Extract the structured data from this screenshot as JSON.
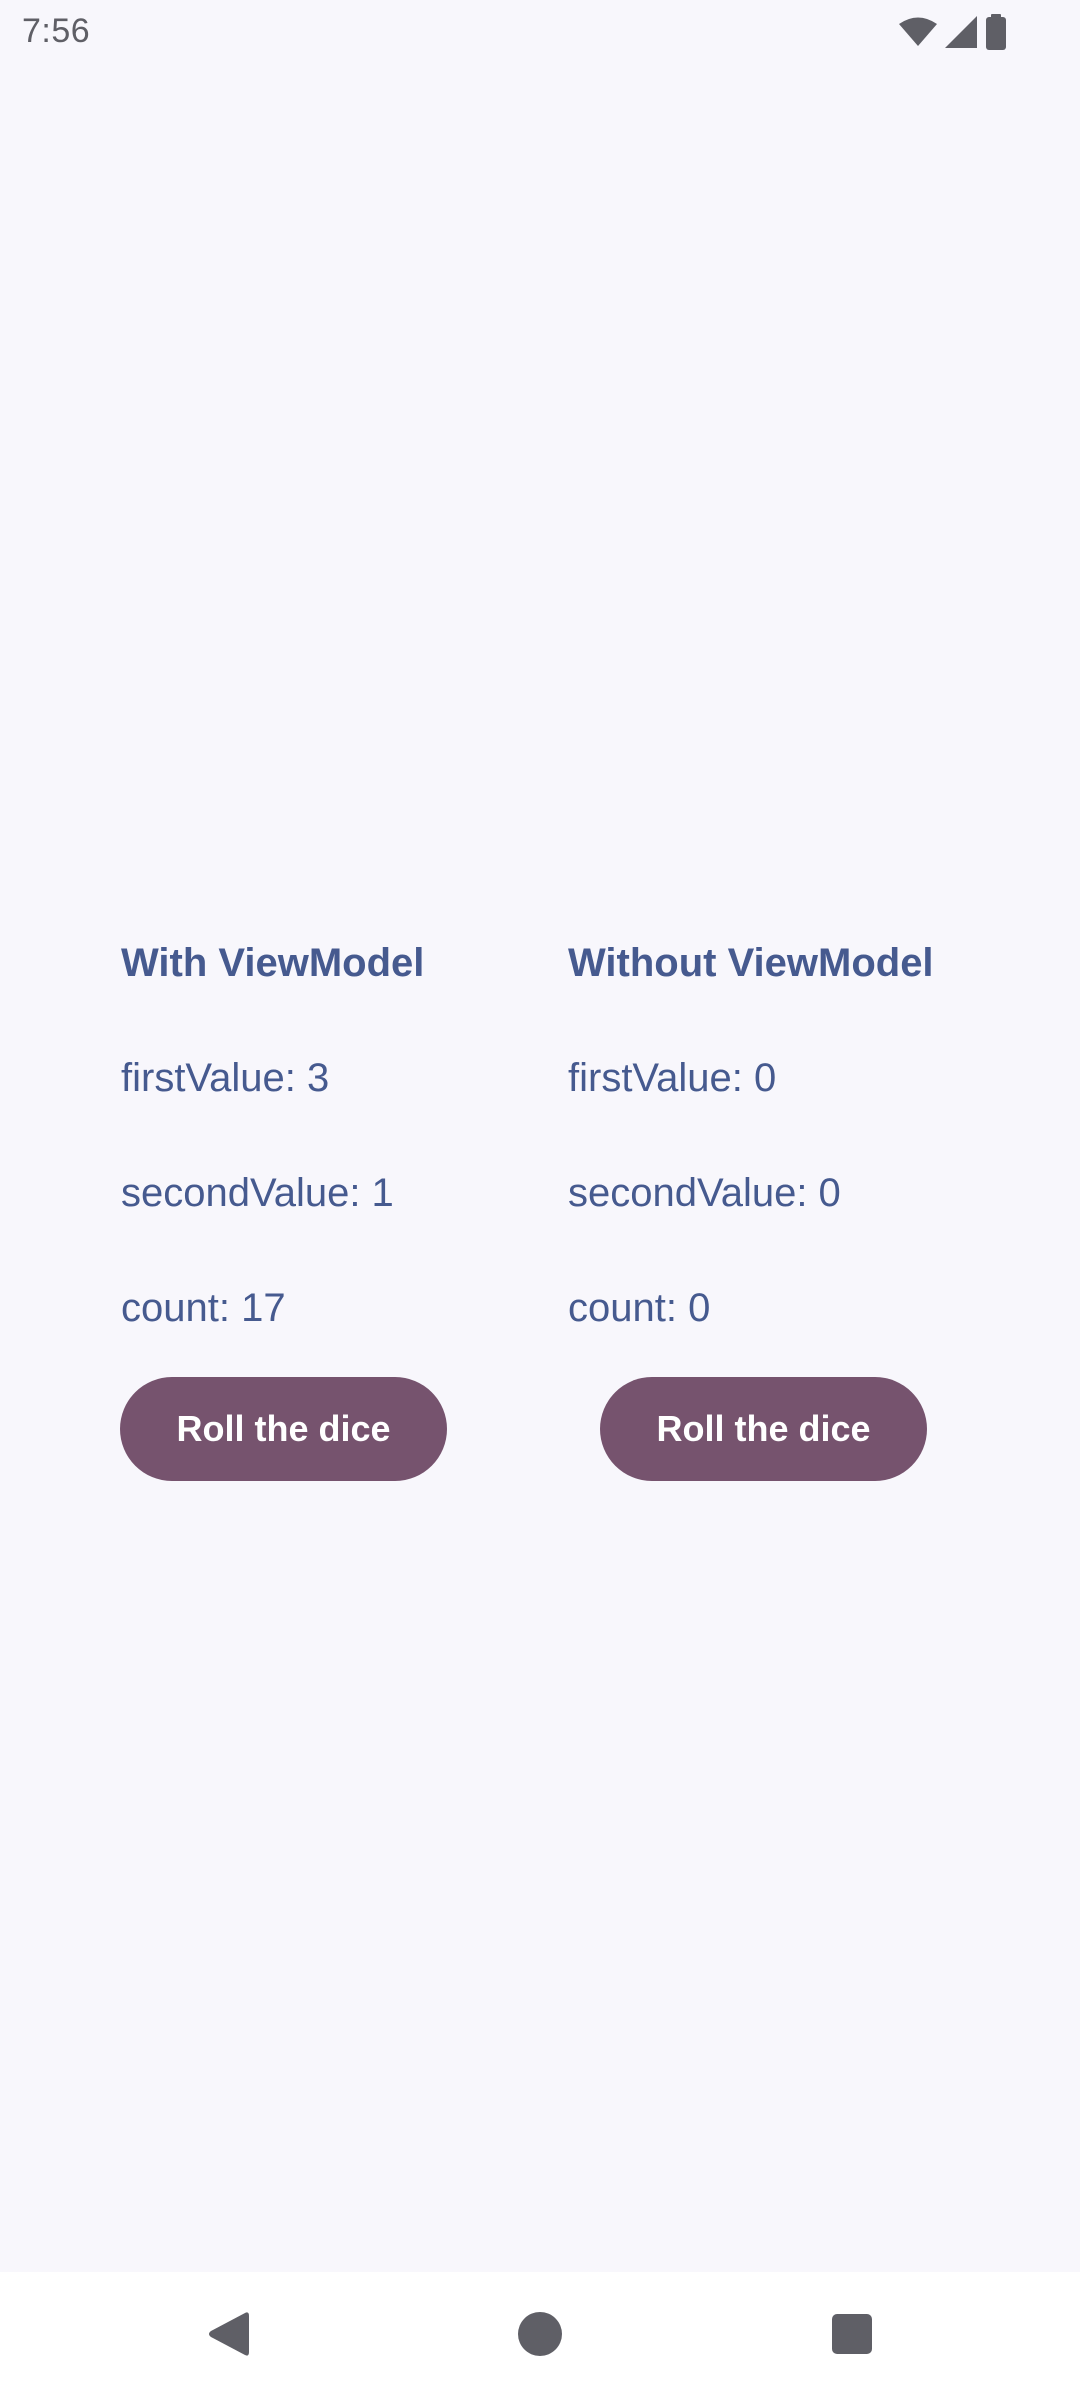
{
  "status_bar": {
    "time": "7:56",
    "icons": [
      "wifi-icon",
      "signal-icon",
      "battery-icon"
    ]
  },
  "with_viewmodel": {
    "title": "With ViewModel",
    "first_value": "firstValue: 3",
    "second_value": "secondValue: 1",
    "count": "count: 17",
    "button_label": "Roll the dice"
  },
  "without_viewmodel": {
    "title": "Without ViewModel",
    "first_value": "firstValue: 0",
    "second_value": "secondValue: 0",
    "count": "count: 0",
    "button_label": "Roll the dice"
  },
  "nav_bar": {
    "icons": [
      "back-icon",
      "home-icon",
      "recents-icon"
    ]
  },
  "colors": {
    "background": "#f8f7fc",
    "text_accent": "#465a8f",
    "button": "#76536e",
    "button_text": "#ffffff",
    "nav_icon": "#5f5f66"
  }
}
